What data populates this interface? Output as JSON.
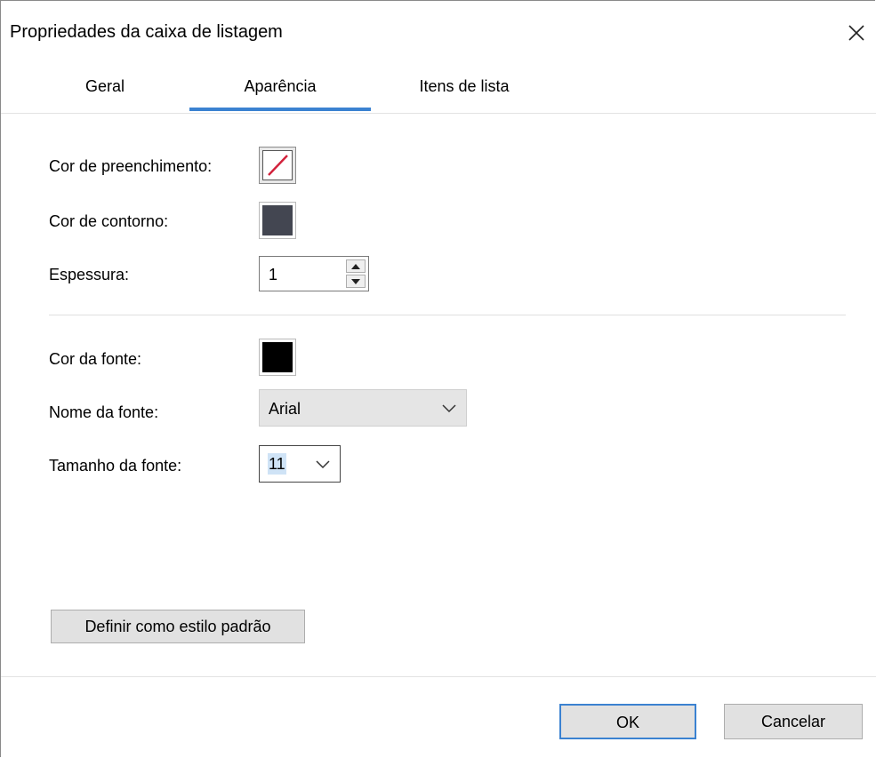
{
  "dialog": {
    "title": "Propriedades da caixa de listagem",
    "close_icon": "close-icon"
  },
  "tabs": [
    {
      "label": "Geral",
      "active": false
    },
    {
      "label": "Aparência",
      "active": true
    },
    {
      "label": "Itens de lista",
      "active": false
    }
  ],
  "appearance": {
    "fill_color_label": "Cor de preenchimento:",
    "fill_color": "none",
    "outline_color_label": "Cor de contorno:",
    "outline_color": "#434651",
    "thickness_label": "Espessura:",
    "thickness_value": "1",
    "font_color_label": "Cor da fonte:",
    "font_color": "#000000",
    "font_name_label": "Nome da fonte:",
    "font_name_value": "Arial",
    "font_size_label": "Tamanho da fonte:",
    "font_size_value": "11",
    "set_default_button": "Definir como estilo padrão"
  },
  "footer": {
    "ok_label": "OK",
    "cancel_label": "Cancelar"
  },
  "colors": {
    "accent": "#3b82d1",
    "no_fill_slash": "#d2213b"
  }
}
